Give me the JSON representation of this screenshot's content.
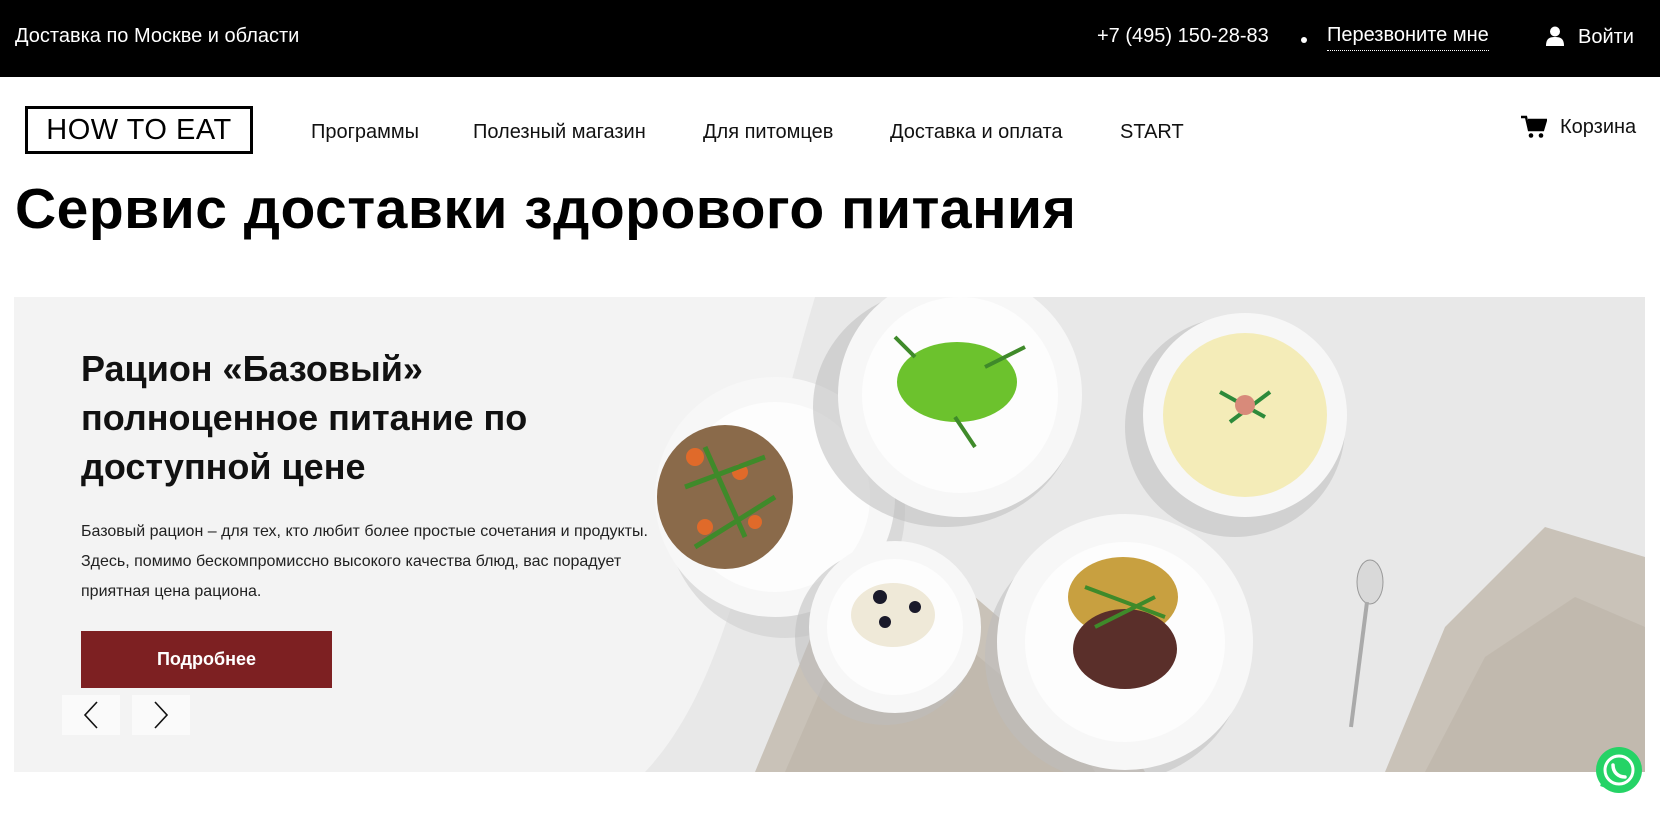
{
  "topbar": {
    "delivery_text": "Доставка по Москве и области",
    "phone": "+7 (495) 150-28-83",
    "callback_label": "Перезвоните мне",
    "login_label": "Войти",
    "login_icon": "user-icon"
  },
  "header": {
    "logo_text": "HOW TO EAT",
    "nav": [
      {
        "label": "Программы"
      },
      {
        "label": "Полезный магазин"
      },
      {
        "label": "Для питомцев"
      },
      {
        "label": "Доставка и оплата"
      },
      {
        "label": "START"
      }
    ],
    "cart_label": "Корзина",
    "cart_icon": "cart-icon"
  },
  "page": {
    "title": "Сервис доставки здорового питания"
  },
  "slider": {
    "title_line1": "Рацион «Базовый»",
    "title_line2": "полноценное питание по",
    "title_line3": "доступной цене",
    "description": "Базовый рацион – для тех, кто любит более простые сочетания и продукты. Здесь, помимо бескомпромиссно высокого качества блюд, вас порадует приятная цена рациона.",
    "button_label": "Подробнее",
    "prev_icon": "chevron-left-icon",
    "next_icon": "chevron-right-icon"
  },
  "colors": {
    "accent": "#7d2022",
    "topbar_bg": "#000000",
    "slider_bg": "#f3f3f3",
    "whatsapp": "#25d366"
  },
  "widgets": {
    "whatsapp_icon": "whatsapp-icon"
  }
}
